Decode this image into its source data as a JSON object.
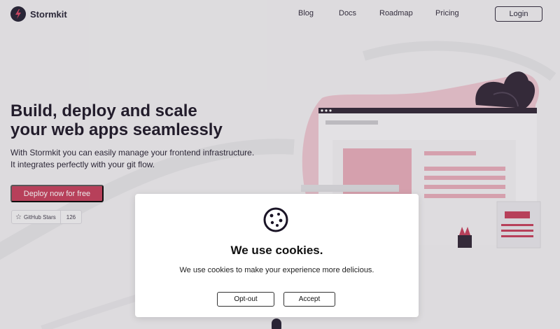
{
  "header": {
    "logo_text": "Stormkit",
    "nav": [
      "Blog",
      "Docs",
      "Roadmap",
      "Pricing"
    ],
    "login_label": "Login"
  },
  "hero": {
    "title_line1": "Build, deploy and scale",
    "title_line2": "your web apps seamlessly",
    "subtitle_line1": "With Stormkit you can easily manage your frontend infrastructure.",
    "subtitle_line2": "It integrates perfectly with your git flow.",
    "cta_label": "Deploy now for free",
    "github_label": "GitHub Stars",
    "github_count": "126"
  },
  "cookie_modal": {
    "title": "We use cookies.",
    "text": "We use cookies to make your experience more delicious.",
    "optout_label": "Opt-out",
    "accept_label": "Accept"
  },
  "colors": {
    "brand_pink": "#c33a57",
    "dark": "#1e1b2e",
    "background": "#efeef0"
  }
}
